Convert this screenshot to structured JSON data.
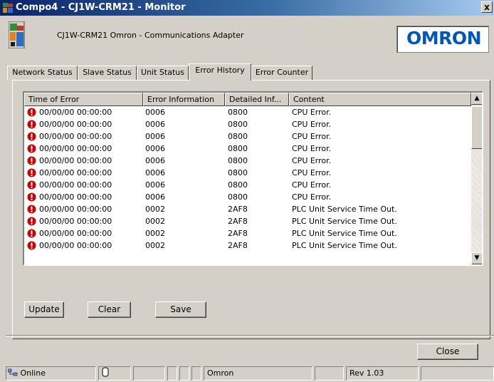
{
  "window": {
    "title": "Compo4 - CJ1W-CRM21 - Monitor",
    "close_glyph": "x"
  },
  "header": {
    "device_label": "CJ1W-CRM21   Omron - Communications Adapter",
    "logo_text": "OMRON",
    "logo_color": "#0057b8"
  },
  "tabs": [
    {
      "label": "Network Status"
    },
    {
      "label": "Slave Status"
    },
    {
      "label": "Unit Status"
    },
    {
      "label": "Error History"
    },
    {
      "label": "Error Counter"
    }
  ],
  "active_tab": "Error History",
  "error_table": {
    "columns": [
      "Time of Error",
      "Error Information",
      "Detailed Inf...",
      "Content"
    ],
    "rows": [
      {
        "time": "00/00/00 00:00:00",
        "info": "0006",
        "detail": "0800",
        "content": "CPU Error."
      },
      {
        "time": "00/00/00 00:00:00",
        "info": "0006",
        "detail": "0800",
        "content": "CPU Error."
      },
      {
        "time": "00/00/00 00:00:00",
        "info": "0006",
        "detail": "0800",
        "content": "CPU Error."
      },
      {
        "time": "00/00/00 00:00:00",
        "info": "0006",
        "detail": "0800",
        "content": "CPU Error."
      },
      {
        "time": "00/00/00 00:00:00",
        "info": "0006",
        "detail": "0800",
        "content": "CPU Error."
      },
      {
        "time": "00/00/00 00:00:00",
        "info": "0006",
        "detail": "0800",
        "content": "CPU Error."
      },
      {
        "time": "00/00/00 00:00:00",
        "info": "0006",
        "detail": "0800",
        "content": "CPU Error."
      },
      {
        "time": "00/00/00 00:00:00",
        "info": "0006",
        "detail": "0800",
        "content": "CPU Error."
      },
      {
        "time": "00/00/00 00:00:00",
        "info": "0002",
        "detail": "2AF8",
        "content": "PLC Unit Service Time Out."
      },
      {
        "time": "00/00/00 00:00:00",
        "info": "0002",
        "detail": "2AF8",
        "content": "PLC Unit Service Time Out."
      },
      {
        "time": "00/00/00 00:00:00",
        "info": "0002",
        "detail": "2AF8",
        "content": "PLC Unit Service Time Out."
      },
      {
        "time": "00/00/00 00:00:00",
        "info": "0002",
        "detail": "2AF8",
        "content": "PLC Unit Service Time Out."
      }
    ],
    "row_icon": "error-icon",
    "error_color": "#cc0000"
  },
  "buttons": {
    "update": "Update",
    "clear": "Clear",
    "save": "Save",
    "close": "Close"
  },
  "statusbar": {
    "connection": "Online",
    "vendor": "Omron",
    "revision": "Rev 1.03"
  }
}
